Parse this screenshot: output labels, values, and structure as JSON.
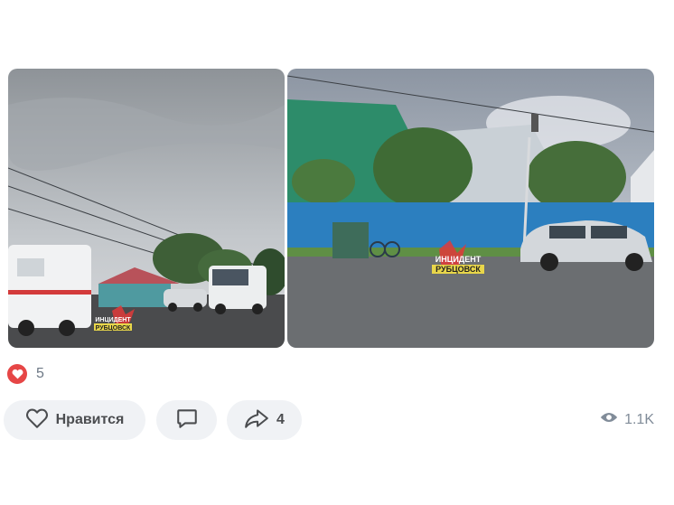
{
  "post": {
    "photos": [
      {
        "watermark_line1": "ИНЦИДЕНТ",
        "watermark_line2": "РУБЦОВСК"
      },
      {
        "watermark_line1": "ИНЦИДЕНТ",
        "watermark_line2": "РУБЦОВСК"
      }
    ]
  },
  "reactions": {
    "icon": "heart-icon",
    "count": "5",
    "color": "#e64646"
  },
  "actions": {
    "like_label": "Нравится",
    "comment_count": "",
    "share_count": "4"
  },
  "views": {
    "icon": "eye-icon",
    "count": "1.1K"
  }
}
